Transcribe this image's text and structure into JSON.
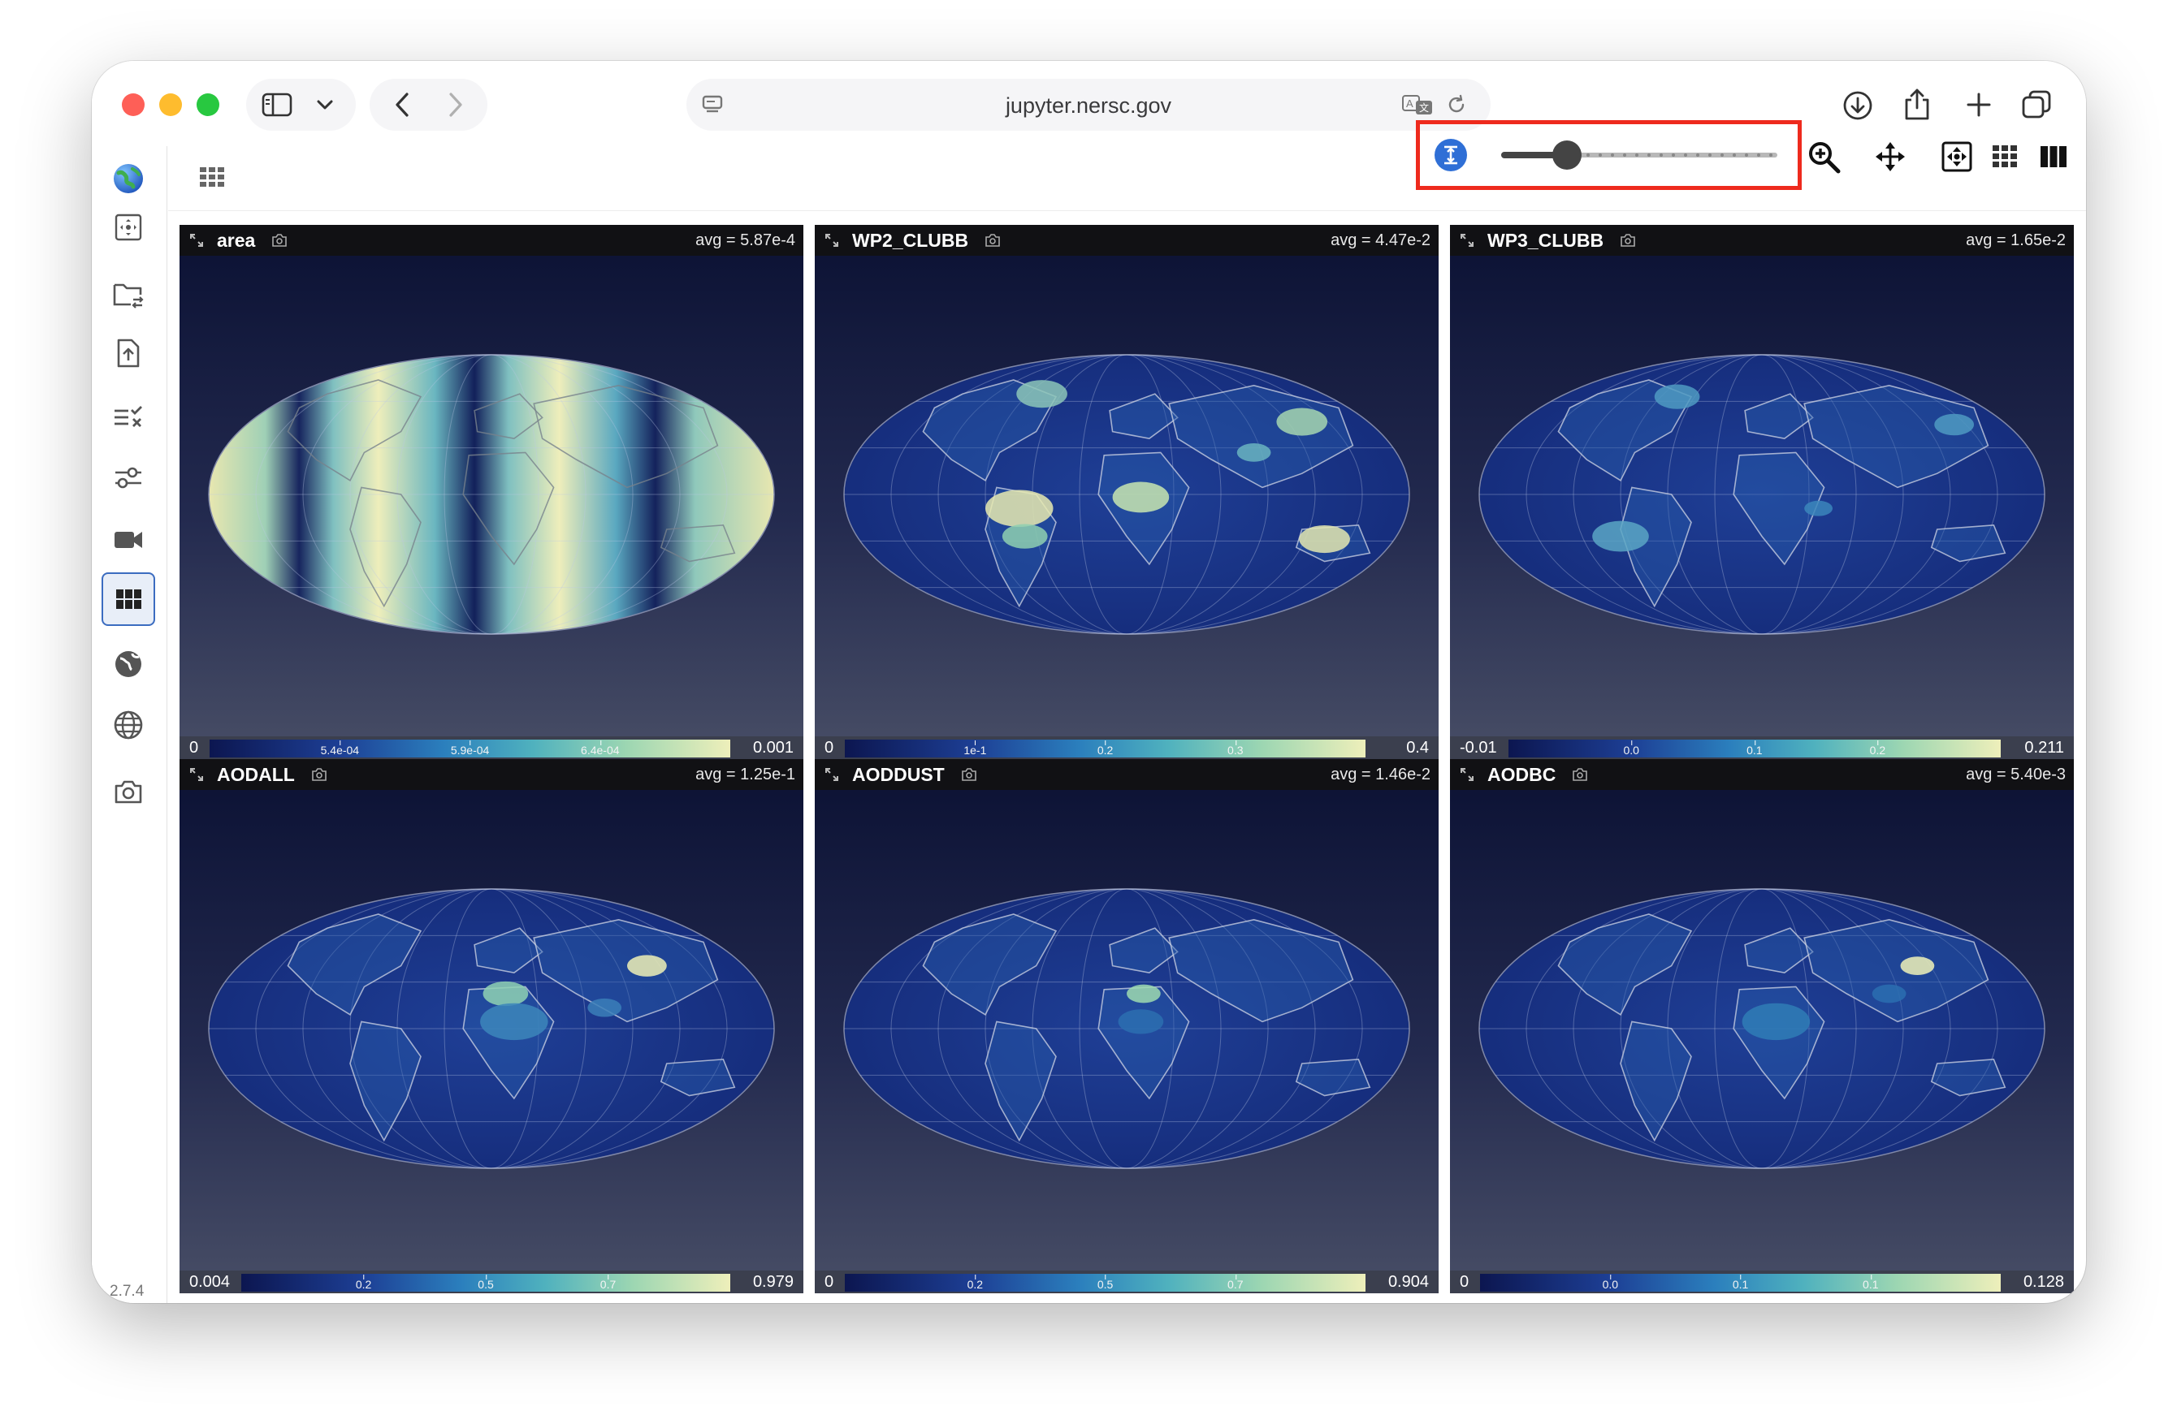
{
  "browser": {
    "url": "jupyter.nersc.gov"
  },
  "app": {
    "version": "2.7.4",
    "sidebar": [
      {
        "name": "globe-logo-icon"
      },
      {
        "name": "reset-view-icon"
      },
      {
        "name": "folder-swap-icon"
      },
      {
        "name": "file-upload-icon"
      },
      {
        "name": "checklist-icon"
      },
      {
        "name": "sliders-icon"
      },
      {
        "name": "camera-video-icon"
      },
      {
        "name": "grid-layout-icon"
      },
      {
        "name": "globe-solid-icon"
      },
      {
        "name": "globe-outline-icon"
      },
      {
        "name": "screenshot-icon"
      }
    ],
    "toolbar": {
      "row_height_slider_value": 0.12
    }
  },
  "panels": [
    {
      "title": "area",
      "avg": "avg = 5.87e-4",
      "min": "0",
      "max": "0.001",
      "ticks": [
        {
          "label": "5.4e-04",
          "pos": 0.25
        },
        {
          "label": "5.9e-04",
          "pos": 0.5
        },
        {
          "label": "6.4e-04",
          "pos": 0.75
        }
      ]
    },
    {
      "title": "WP2_CLUBB",
      "avg": "avg = 4.47e-2",
      "min": "0",
      "max": "0.4",
      "ticks": [
        {
          "label": "1e-1",
          "pos": 0.25
        },
        {
          "label": "0.2",
          "pos": 0.5
        },
        {
          "label": "0.3",
          "pos": 0.75
        }
      ]
    },
    {
      "title": "WP3_CLUBB",
      "avg": "avg = 1.65e-2",
      "min": "-0.01",
      "max": "0.211",
      "ticks": [
        {
          "label": "0.0",
          "pos": 0.25
        },
        {
          "label": "0.1",
          "pos": 0.5
        },
        {
          "label": "0.2",
          "pos": 0.75
        }
      ]
    },
    {
      "title": "AODALL",
      "avg": "avg = 1.25e-1",
      "min": "0.004",
      "max": "0.979",
      "ticks": [
        {
          "label": "0.2",
          "pos": 0.25
        },
        {
          "label": "0.5",
          "pos": 0.5
        },
        {
          "label": "0.7",
          "pos": 0.75
        }
      ]
    },
    {
      "title": "AODDUST",
      "avg": "avg = 1.46e-2",
      "min": "0",
      "max": "0.904",
      "ticks": [
        {
          "label": "0.2",
          "pos": 0.25
        },
        {
          "label": "0.5",
          "pos": 0.5
        },
        {
          "label": "0.7",
          "pos": 0.75
        }
      ]
    },
    {
      "title": "AODBC",
      "avg": "avg = 5.40e-3",
      "min": "0",
      "max": "0.128",
      "ticks": [
        {
          "label": "0.0",
          "pos": 0.25
        },
        {
          "label": "0.1",
          "pos": 0.5
        },
        {
          "label": "0.1",
          "pos": 0.75
        }
      ]
    }
  ]
}
